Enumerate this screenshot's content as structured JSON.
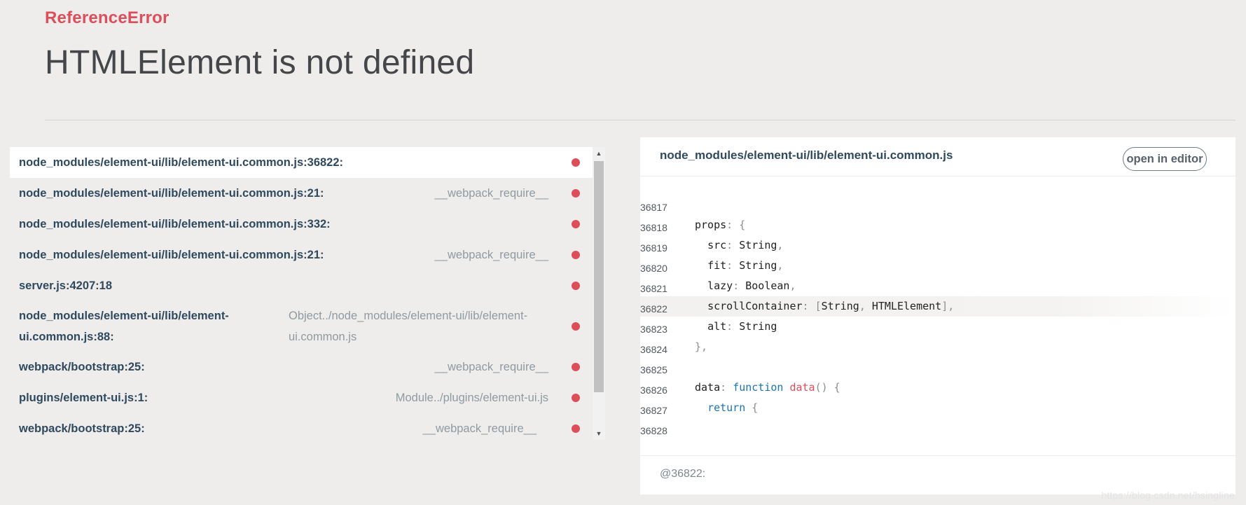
{
  "error": {
    "type": "ReferenceError",
    "message": "HTMLElement is not defined"
  },
  "stack": {
    "frames": [
      {
        "file": "node_modules/element-ui/lib/element-ui.common.js:36822:",
        "fn": "",
        "active": true
      },
      {
        "file": "node_modules/element-ui/lib/element-ui.common.js:21:",
        "fn": "__webpack_require__"
      },
      {
        "file": "node_modules/element-ui/lib/element-ui.common.js:332:",
        "fn": ""
      },
      {
        "file": "node_modules/element-ui/lib/element-ui.common.js:21:",
        "fn": "__webpack_require__"
      },
      {
        "file": "server.js:4207:18",
        "fn": ""
      },
      {
        "file": "node_modules/element-ui/lib/element-ui.common.js:88:",
        "file_line1": "node_modules/element-ui/lib/element-",
        "file_line2": "ui.common.js:88:",
        "fn_line1": "Object../node_modules/element-ui/lib/element-",
        "fn_line2": "ui.common.js"
      },
      {
        "file": "webpack/bootstrap:25:",
        "fn": "__webpack_require__"
      },
      {
        "file": "plugins/element-ui.js:1:",
        "fn": "Module../plugins/element-ui.js"
      },
      {
        "file": "webpack/bootstrap:25:",
        "fn": "__webpack_require__"
      }
    ],
    "scroll_up_icon": "triangle-up-icon",
    "scroll_down_icon": "triangle-down-icon"
  },
  "source": {
    "file": "node_modules/element-ui/lib/element-ui.common.js",
    "open_label": "open in editor",
    "lines": [
      {
        "n": "36817",
        "code": ""
      },
      {
        "n": "36818",
        "code": "props: {"
      },
      {
        "n": "36819",
        "code": "  src: String,"
      },
      {
        "n": "36820",
        "code": "  fit: String,"
      },
      {
        "n": "36821",
        "code": "  lazy: Boolean,"
      },
      {
        "n": "36822",
        "code": "  scrollContainer: [String, HTMLElement],",
        "highlight": true
      },
      {
        "n": "36823",
        "code": "  alt: String"
      },
      {
        "n": "36824",
        "code": "},"
      },
      {
        "n": "36825",
        "code": ""
      },
      {
        "n": "36826",
        "code": "data: function data() {"
      },
      {
        "n": "36827",
        "code": "  return {"
      },
      {
        "n": "36828",
        "code": ""
      }
    ],
    "footer": "@36822:"
  },
  "watermark": "https://blog.csdn.net/hsingline",
  "colors": {
    "accent_red": "#dc4f5a",
    "keyword_blue": "#1b73b3",
    "background": "#eeedec"
  }
}
